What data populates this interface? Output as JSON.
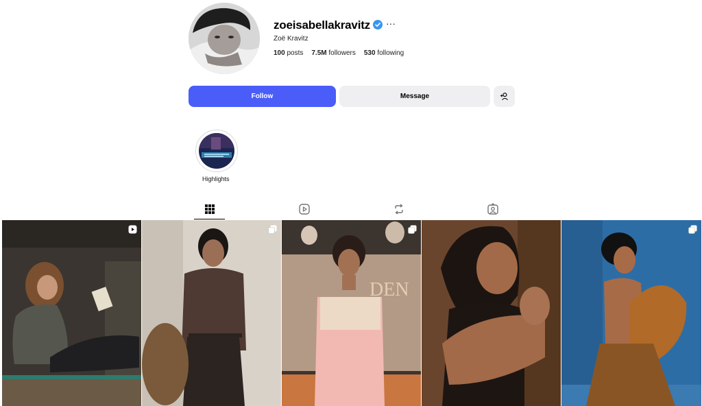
{
  "profile": {
    "username": "zoeisabellakravitz",
    "full_name": "Zoë Kravitz",
    "more_label": "···",
    "posts_count": "100",
    "posts_label": "posts",
    "followers_count": "7.5M",
    "followers_label": "followers",
    "following_count": "530",
    "following_label": "following"
  },
  "actions": {
    "follow_label": "Follow",
    "message_label": "Message"
  },
  "highlights": [
    {
      "label": "Highlights"
    }
  ],
  "tabs": [
    "posts-grid-icon",
    "reels-icon",
    "reposts-icon",
    "tagged-icon"
  ],
  "posts": [
    {
      "badge": "reel-icon"
    },
    {
      "badge": "carousel-icon"
    },
    {
      "badge": "carousel-icon"
    },
    {
      "badge": "none"
    },
    {
      "badge": "carousel-icon"
    }
  ],
  "colors": {
    "follow_button": "#4a5df9",
    "secondary_button": "#efeff1",
    "verified_badge": "#3897f0"
  }
}
